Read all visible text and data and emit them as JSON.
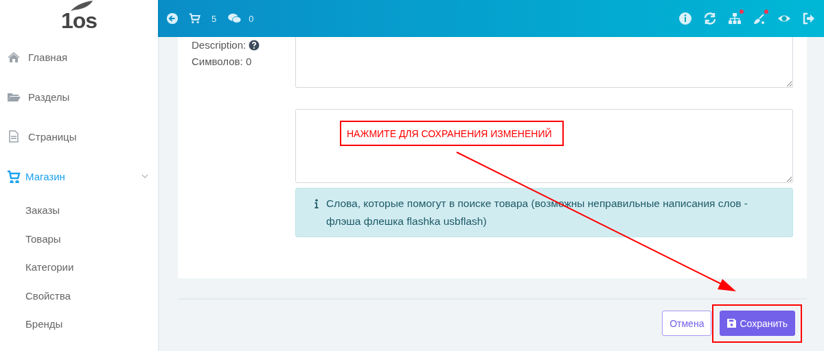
{
  "logo": {
    "text": "1os"
  },
  "header": {
    "cart_count": "5",
    "messages_count": "0",
    "right_icons": [
      {
        "kind": "info",
        "badge": false
      },
      {
        "kind": "refresh",
        "badge": false
      },
      {
        "kind": "sitemap",
        "badge": true
      },
      {
        "kind": "brush",
        "badge": true
      },
      {
        "kind": "eye",
        "badge": false
      },
      {
        "kind": "logout",
        "badge": false
      }
    ]
  },
  "sidebar": {
    "items": [
      {
        "kind": "home",
        "label": "Главная",
        "selected": false
      },
      {
        "kind": "folder",
        "label": "Разделы",
        "selected": false
      },
      {
        "kind": "page",
        "label": "Страницы",
        "selected": false
      },
      {
        "kind": "cart",
        "label": "Магазин",
        "selected": true,
        "expanded": true,
        "children": [
          {
            "label": "Заказы",
            "selected": false
          },
          {
            "label": "Товары",
            "selected": false
          },
          {
            "label": "Категории",
            "selected": false
          },
          {
            "label": "Свойства",
            "selected": false
          },
          {
            "label": "Бренды",
            "selected": false
          }
        ]
      }
    ]
  },
  "form": {
    "description_label": "Description:",
    "char_count": "Символов: 0",
    "info_text": "Слова, которые помогут в поиске товара (возможны неправильные написания слов - флэша флешка flashka usbflash)"
  },
  "buttons": {
    "cancel": "Отмена",
    "save": "Сохранить"
  },
  "annotation": {
    "callout": "НАЖМИТЕ ДЛЯ СОХРАНЕНИЯ ИЗМЕНЕНИЙ"
  }
}
